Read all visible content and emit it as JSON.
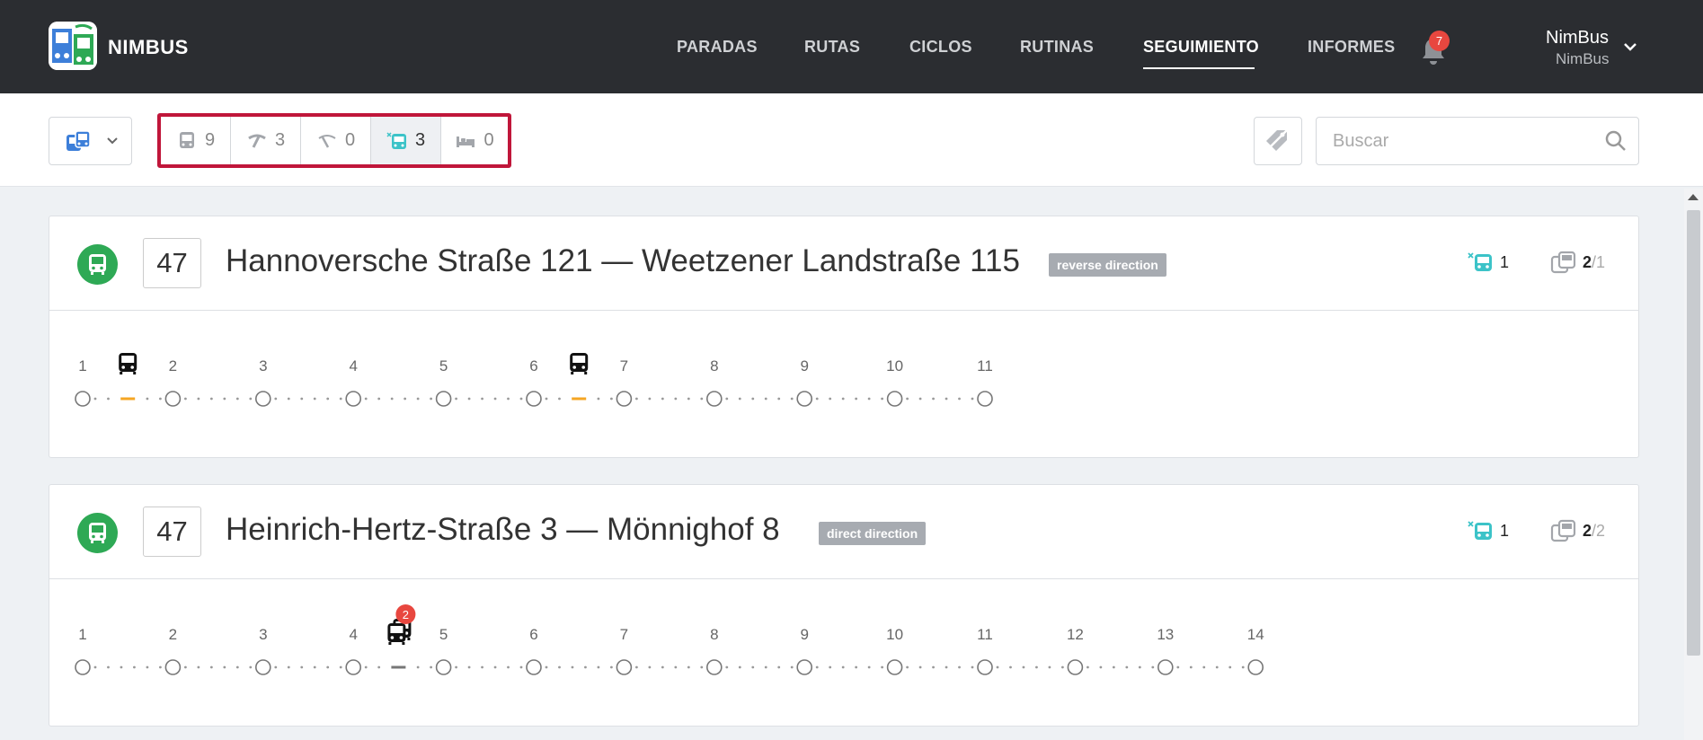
{
  "app": {
    "brand": "NIMBUS"
  },
  "nav": {
    "items": [
      {
        "label": "PARADAS",
        "active": false
      },
      {
        "label": "RUTAS",
        "active": false
      },
      {
        "label": "CICLOS",
        "active": false
      },
      {
        "label": "RUTINAS",
        "active": false
      },
      {
        "label": "SEGUIMIENTO",
        "active": true
      },
      {
        "label": "INFORMES",
        "active": false
      }
    ],
    "notifications": "7",
    "user_name": "NimBus",
    "user_sub": "NimBus"
  },
  "toolbar": {
    "vehicle_type_icon": "bus-pair-icon",
    "filters": [
      {
        "icon": "bus-icon",
        "count": "9",
        "active": false
      },
      {
        "icon": "signal-icon",
        "count": "3",
        "active": false
      },
      {
        "icon": "signal-lost-icon",
        "count": "0",
        "active": false
      },
      {
        "icon": "bus-offline-icon",
        "count": "3",
        "active": true
      },
      {
        "icon": "bed-icon",
        "count": "0",
        "active": false
      }
    ],
    "search_placeholder": "Buscar"
  },
  "colors": {
    "navbar": "#2b2d31",
    "route_green": "#2ea955",
    "highlight_border": "#c0163a",
    "offline_teal": "#3cc3c8",
    "vehicle_marker": "#f5a623",
    "badge_red": "#e8473f",
    "direction_badge": "#a7abb1"
  },
  "routes": [
    {
      "number": "47",
      "title": "Hannoversche Straße 121 — Weetzener Landstraße 115",
      "direction": "reverse direction",
      "offline_count": "1",
      "buses_active": "2",
      "buses_total": "/1",
      "stops": [
        "1",
        "2",
        "3",
        "4",
        "5",
        "6",
        "7",
        "8",
        "9",
        "10",
        "11"
      ],
      "vehicles": [
        {
          "between_stop": 1,
          "fraction": 0.5,
          "count": 1,
          "marker": "orange"
        },
        {
          "between_stop": 6,
          "fraction": 0.5,
          "count": 1,
          "marker": "orange"
        }
      ]
    },
    {
      "number": "47",
      "title": "Heinrich-Hertz-Straße 3 — Mönnighof 8",
      "direction": "direct direction",
      "offline_count": "1",
      "buses_active": "2",
      "buses_total": "/2",
      "stops": [
        "1",
        "2",
        "3",
        "4",
        "5",
        "6",
        "7",
        "8",
        "9",
        "10",
        "11",
        "12",
        "13",
        "14"
      ],
      "vehicles": [
        {
          "between_stop": 4,
          "fraction": 0.5,
          "count": 2,
          "badge": "2",
          "marker": "gray"
        }
      ]
    }
  ]
}
